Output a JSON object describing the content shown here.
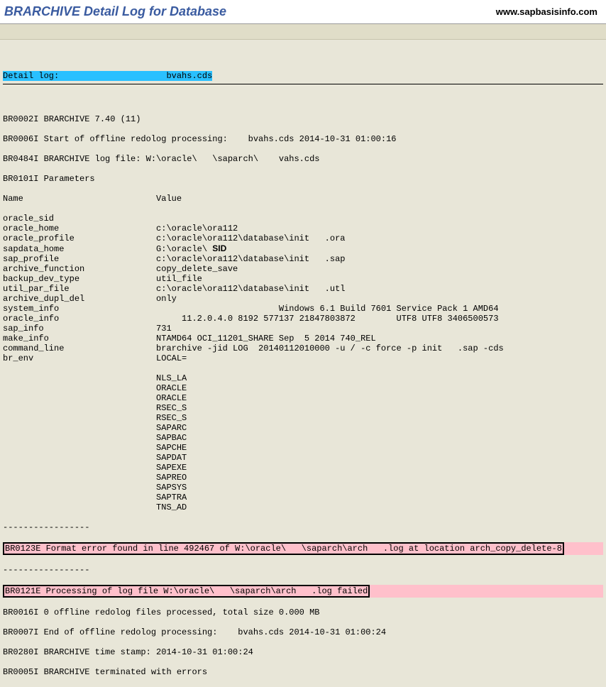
{
  "header": {
    "title": "BRARCHIVE Detail Log for Database",
    "site": "www.sapbasisinfo.com"
  },
  "log_header": {
    "label": "Detail log:                     bvahs.cds"
  },
  "intro": [
    "BR0002I BRARCHIVE 7.40 (11)",
    "BR0006I Start of offline redolog processing:    bvahs.cds 2014-10-31 01:00:16",
    "BR0484I BRARCHIVE log file: W:\\oracle\\   \\saparch\\    vahs.cds",
    "BR0101I Parameters"
  ],
  "param_header": {
    "name": "Name",
    "value": "Value"
  },
  "params": [
    {
      "k": "oracle_sid",
      "v": ""
    },
    {
      "k": "oracle_home",
      "v": "c:\\oracle\\ora112"
    },
    {
      "k": "oracle_profile",
      "v": "c:\\oracle\\ora112\\database\\init   .ora"
    },
    {
      "k": "sapdata_home",
      "v": "G:\\oracle\\ ",
      "sid": "SID"
    },
    {
      "k": "sap_profile",
      "v": "c:\\oracle\\ora112\\database\\init   .sap"
    },
    {
      "k": "archive_function",
      "v": "copy_delete_save"
    },
    {
      "k": "backup_dev_type",
      "v": "util_file"
    },
    {
      "k": "util_par_file",
      "v": "c:\\oracle\\ora112\\database\\init   .utl"
    },
    {
      "k": "archive_dupl_del",
      "v": "only"
    },
    {
      "k": "system_info",
      "v": "                        Windows 6.1 Build 7601 Service Pack 1 AMD64"
    },
    {
      "k": "oracle_info",
      "v": "     11.2.0.4.0 8192 577137 21847803872        UTF8 UTF8 3406500573"
    },
    {
      "k": "sap_info",
      "v": "731"
    },
    {
      "k": "make_info",
      "v": "NTAMD64 OCI_11201_SHARE Sep  5 2014 740_REL"
    },
    {
      "k": "command_line",
      "v": "brarchive -jid LOG  20140112010000 -u / -c force -p init   .sap -cds"
    },
    {
      "k": "br_env",
      "v": "LOCAL="
    }
  ],
  "env_cont": [
    "NLS_LA",
    "ORACLE",
    "ORACLE",
    "RSEC_S",
    "RSEC_S",
    "SAPARC",
    "SAPBAC",
    "SAPCHE",
    "SAPDAT",
    "SAPEXE",
    "SAPREO",
    "SAPSYS",
    "SAPTRA",
    "TNS_AD"
  ],
  "error1": "BR0123E Format error found in line 492467 of W:\\oracle\\   \\saparch\\arch   .log at location arch_copy_delete-8",
  "error2": "BR0121E Processing of log file W:\\oracle\\   \\saparch\\arch   .log failed",
  "footer": [
    "BR0016I 0 offline redolog files processed, total size 0.000 MB",
    "BR0007I End of offline redolog processing:    bvahs.cds 2014-10-31 01:00:24",
    "BR0280I BRARCHIVE time stamp: 2014-10-31 01:00:24",
    "BR0005I BRARCHIVE terminated with errors"
  ],
  "dashes": "-----------------"
}
